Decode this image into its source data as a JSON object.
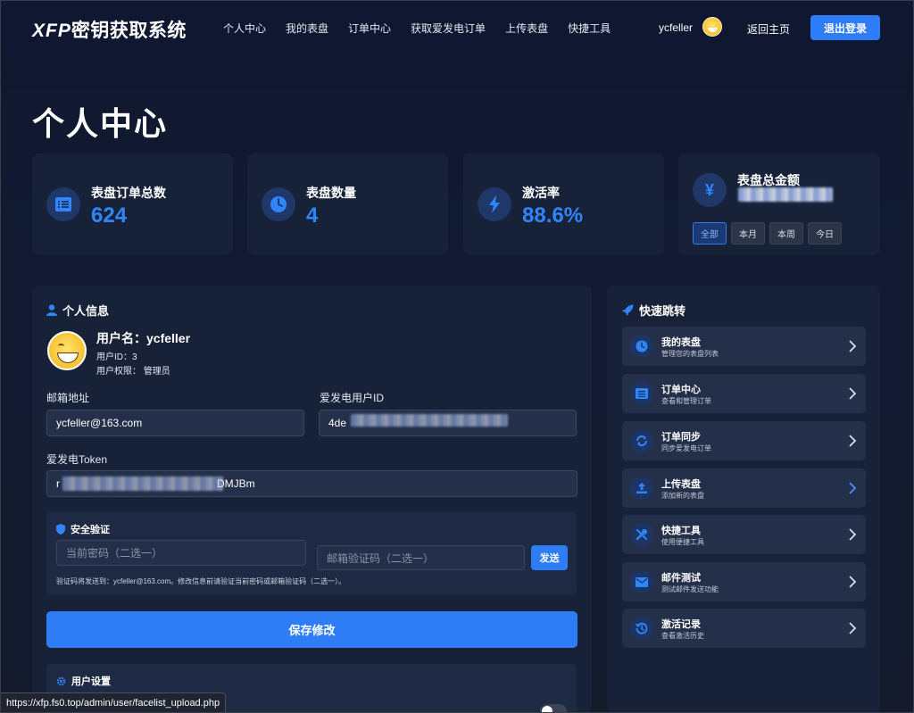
{
  "nav": {
    "logo_prefix": "XFP",
    "logo_text": "密钥获取系统",
    "menu": [
      "个人中心",
      "我的表盘",
      "订单中心",
      "获取爱发电订单",
      "上传表盘",
      "快捷工具"
    ],
    "username": "ycfeller",
    "home_label": "返回主页",
    "logout_label": "退出登录"
  },
  "page_title": "个人中心",
  "stats": [
    {
      "label": "表盘订单总数",
      "value": "624",
      "icon": "list-icon"
    },
    {
      "label": "表盘数量",
      "value": "4",
      "icon": "clock-icon"
    },
    {
      "label": "激活率",
      "value": "88.6%",
      "icon": "bolt-icon"
    },
    {
      "label": "表盘总金额",
      "value": "",
      "icon": "yen-icon",
      "ranges": [
        "全部",
        "本月",
        "本周",
        "今日"
      ],
      "active_range": "全部"
    }
  ],
  "profile": {
    "section_title": "个人信息",
    "username_line": "用户名：ycfeller",
    "user_id_line": "用户ID：3",
    "role_line": "用户权限： 管理员",
    "email_label": "邮箱地址",
    "email_value": "ycfeller@163.com",
    "afdian_id_label": "爱发电用户ID",
    "afdian_id_value": "4de",
    "token_label": "爱发电Token",
    "token_prefix": "r",
    "token_suffix": "DMJBm"
  },
  "security": {
    "title": "安全验证",
    "password_placeholder": "当前密码（二选一）",
    "code_placeholder": "邮箱验证码（二选一）",
    "send_label": "发送",
    "note": "验证码将发送到：ycfeller@163.com。修改信息前请验证当前密码或邮箱验证码（二选一）。"
  },
  "save_label": "保存修改",
  "user_settings_title": "用户设置",
  "quick": {
    "title": "快速跳转",
    "items": [
      {
        "title": "我的表盘",
        "desc": "管理您的表盘列表",
        "icon": "clock-icon"
      },
      {
        "title": "订单中心",
        "desc": "查看和管理订单",
        "icon": "list-icon"
      },
      {
        "title": "订单同步",
        "desc": "同步爱发电订单",
        "icon": "sync-icon"
      },
      {
        "title": "上传表盘",
        "desc": "添加新的表盘",
        "icon": "upload-icon"
      },
      {
        "title": "快捷工具",
        "desc": "使用便捷工具",
        "icon": "tools-icon"
      },
      {
        "title": "邮件测试",
        "desc": "测试邮件发送功能",
        "icon": "mail-icon"
      },
      {
        "title": "激活记录",
        "desc": "查看激活历史",
        "icon": "history-icon"
      }
    ]
  },
  "status_url": "https://xfp.fs0.top/admin/user/facelist_upload.php",
  "colors": {
    "accent": "#2f7df6",
    "stat_value": "#2f86ff",
    "card_bg": "#172239"
  }
}
